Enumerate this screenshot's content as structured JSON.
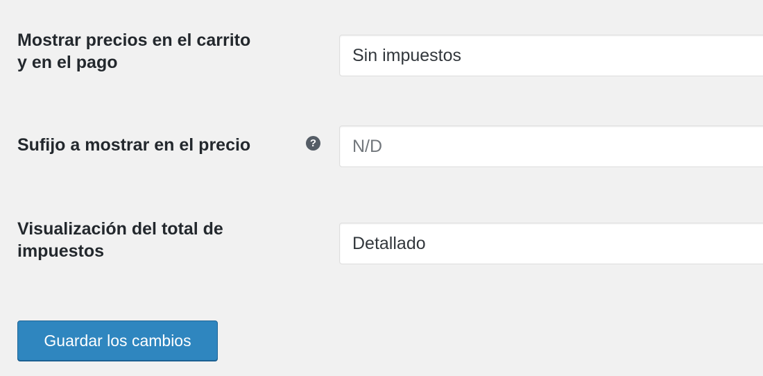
{
  "form": {
    "fields": [
      {
        "label_line1": "Mostrar precios en el carrito",
        "label_line2": "y en el pago",
        "value": "Sin impuestos"
      },
      {
        "label": "Sufijo a mostrar en el precio",
        "help_glyph": "?",
        "placeholder": "N/D"
      },
      {
        "label_line1": "Visualización del total de",
        "label_line2": "impuestos",
        "value": "Detallado"
      }
    ],
    "save_label": "Guardar los cambios"
  },
  "icons": {
    "help": "help-icon"
  },
  "colors": {
    "page_background": "#f1f1f1",
    "label_text": "#23282d",
    "field_background": "#ffffff",
    "field_border": "#dddddd",
    "help_icon_background": "#555d66",
    "button_background": "#2f86bf",
    "button_text": "#ffffff"
  }
}
